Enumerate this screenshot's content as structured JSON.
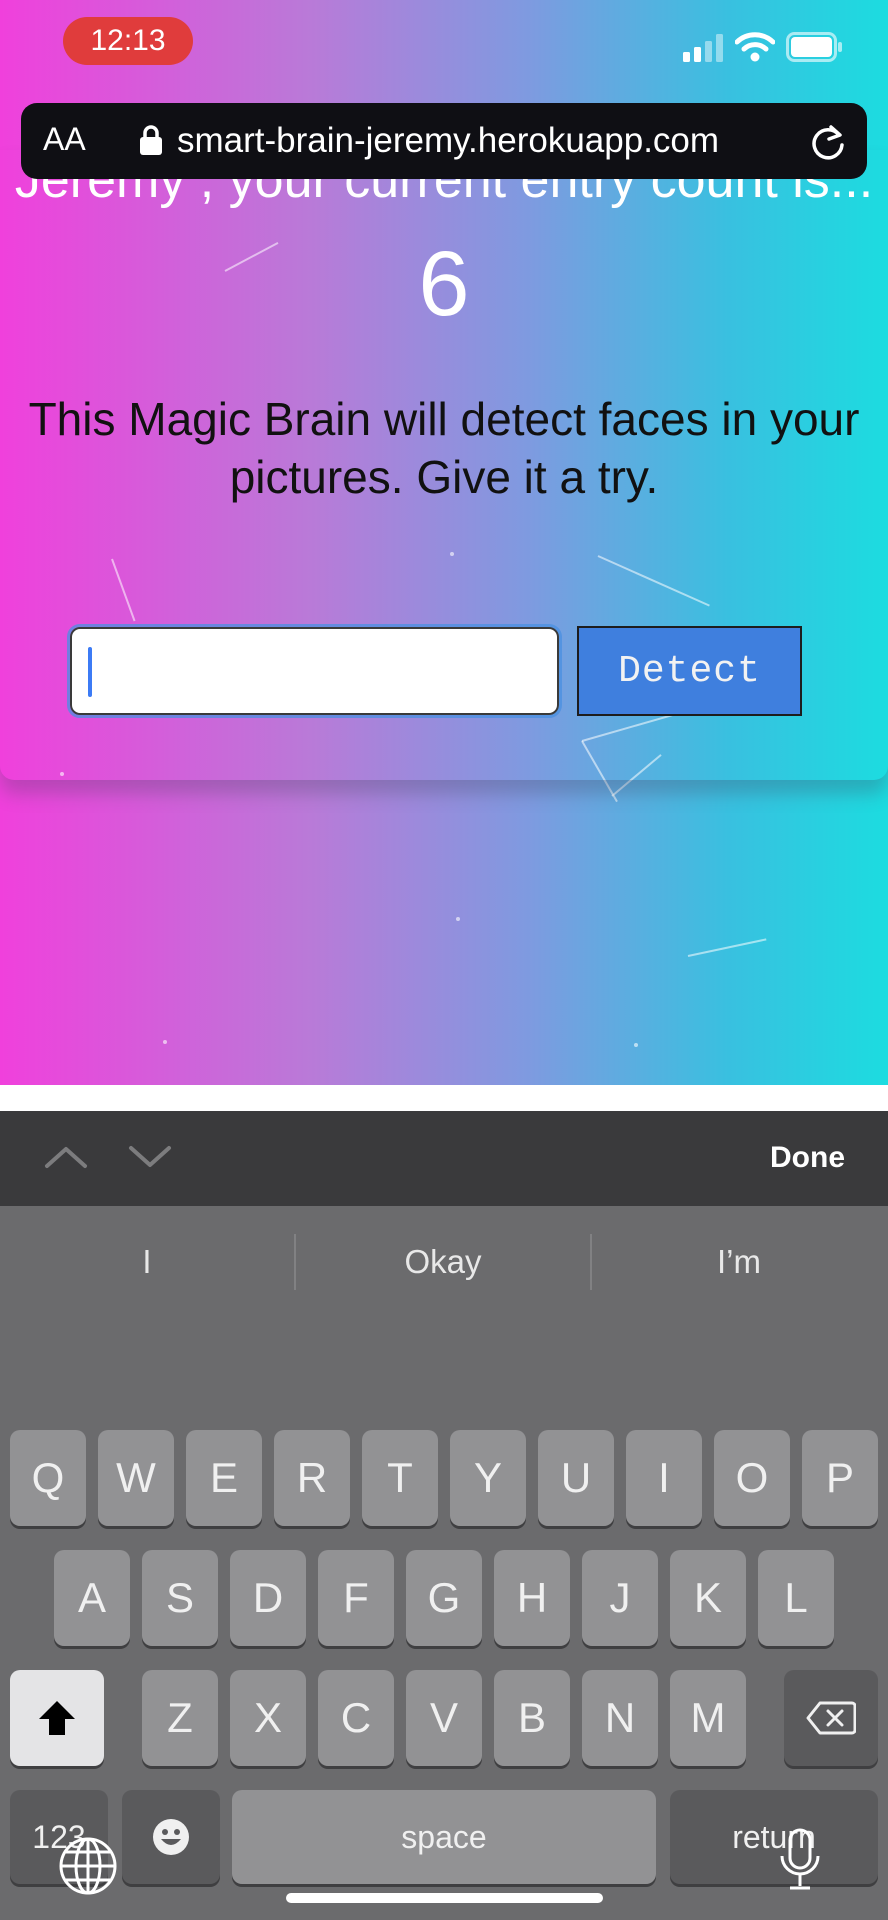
{
  "status_bar": {
    "time": "12:13",
    "signal_icon": "cellular-signal-icon",
    "wifi_icon": "wifi-icon",
    "battery_icon": "battery-icon"
  },
  "browser": {
    "text_size_label": "AA",
    "url": "smart-brain-jeremy.herokuapp.com",
    "lock_icon": "lock-icon",
    "reload_icon": "reload-icon"
  },
  "page": {
    "entry_message_partial": "Jeremy , your current entry count is...",
    "entry_count": "6",
    "intro": "This Magic Brain will detect faces in your pictures. Give it a try.",
    "input_value": "",
    "detect_label": "Detect",
    "colors": {
      "gradient_left": "#f040dc",
      "gradient_right": "#1cdce0",
      "button": "#3f7fde"
    }
  },
  "keyboard": {
    "done_label": "Done",
    "prev_icon": "chevron-up-icon",
    "next_icon": "chevron-down-icon",
    "suggestions": [
      "I",
      "Okay",
      "I’m"
    ],
    "row1": [
      "Q",
      "W",
      "E",
      "R",
      "T",
      "Y",
      "U",
      "I",
      "O",
      "P"
    ],
    "row2": [
      "A",
      "S",
      "D",
      "F",
      "G",
      "H",
      "J",
      "K",
      "L"
    ],
    "row3": [
      "Z",
      "X",
      "C",
      "V",
      "B",
      "N",
      "M"
    ],
    "numbers_label": "123",
    "space_label": "space",
    "return_label": "return",
    "shift_icon": "shift-icon",
    "delete_icon": "delete-icon",
    "emoji_icon": "emoji-icon",
    "globe_icon": "globe-icon",
    "mic_icon": "microphone-icon"
  }
}
